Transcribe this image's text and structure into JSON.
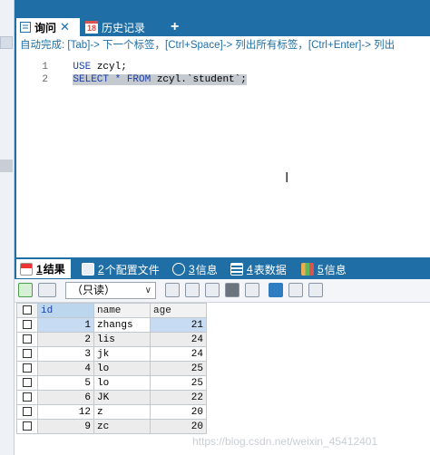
{
  "tabs": [
    {
      "label": "询问",
      "active": true
    },
    {
      "label": "历史记录",
      "active": false
    }
  ],
  "tab_add_label": "+",
  "tab_close_label": "✕",
  "history_badge": "18",
  "editor": {
    "autocomplete_hint": "自动完成: [Tab]-> 下一个标签，[Ctrl+Space]-> 列出所有标签，[Ctrl+Enter]-> 列出",
    "lines": [
      {
        "num": "1",
        "keyword": "USE",
        "rest": " zcyl;"
      },
      {
        "num": "2",
        "keyword": "SELECT * FROM",
        "rest": " zcyl.`student`;"
      }
    ],
    "cursor_glyph": "I"
  },
  "result_tabs": [
    {
      "num": "1",
      "label": "结果",
      "icon": "grid-result-icon",
      "active": true
    },
    {
      "num": "2",
      "label": "个配置文件",
      "icon": "profile-icon",
      "active": false
    },
    {
      "num": "3",
      "label": "信息",
      "icon": "info-icon",
      "active": false
    },
    {
      "num": "4",
      "label": "表数据",
      "icon": "table-data-icon",
      "active": false
    },
    {
      "num": "5",
      "label": "信息",
      "icon": "info-chart-icon",
      "active": false
    }
  ],
  "toolbar": {
    "readonly_label": "（只读）",
    "dropdown_arrow": "∨"
  },
  "grid": {
    "columns": [
      "id",
      "name",
      "age"
    ],
    "rows": [
      {
        "id": "1",
        "name": "zhangs",
        "age": "21"
      },
      {
        "id": "2",
        "name": "lis",
        "age": "24"
      },
      {
        "id": "3",
        "name": "jk",
        "age": "24"
      },
      {
        "id": "4",
        "name": "lo",
        "age": "25"
      },
      {
        "id": "5",
        "name": "lo",
        "age": "25"
      },
      {
        "id": "6",
        "name": "JK",
        "age": "22"
      },
      {
        "id": "12",
        "name": "z",
        "age": "20"
      },
      {
        "id": "9",
        "name": "zc",
        "age": "20"
      }
    ]
  },
  "watermark": "https://blog.csdn.net/weixin_45412401",
  "colors": {
    "accent": "#1f6fa6",
    "keyword": "#1a3fa8",
    "selection": "#c5c9d0"
  }
}
